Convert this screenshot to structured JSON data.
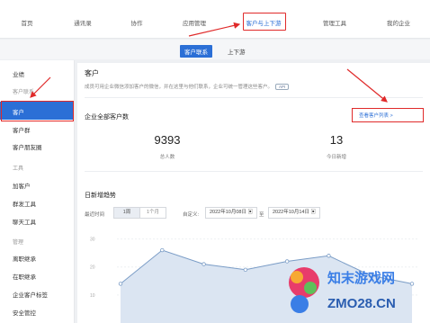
{
  "topnav": {
    "items": [
      "首页",
      "通讯录",
      "协作",
      "应用管理",
      "客户与上下游",
      "管理工具",
      "我的企业"
    ],
    "active_index": 4
  },
  "subtabs": {
    "items": [
      "客户联系",
      "上下游"
    ],
    "active_index": 0
  },
  "sidebar": {
    "items": [
      {
        "label": "业绩",
        "group": false
      },
      {
        "label": "客户联系",
        "group": true
      },
      {
        "label": "客户",
        "group": false,
        "active": true
      },
      {
        "label": "客户群",
        "group": false
      },
      {
        "label": "客户朋友圈",
        "group": false
      },
      {
        "label": "工具",
        "group": true
      },
      {
        "label": "加客户",
        "group": false
      },
      {
        "label": "群发工具",
        "group": false
      },
      {
        "label": "聊天工具",
        "group": false
      },
      {
        "label": "管理",
        "group": true
      },
      {
        "label": "离职继承",
        "group": false
      },
      {
        "label": "在职继承",
        "group": false
      },
      {
        "label": "企业客户标签",
        "group": false
      },
      {
        "label": "安全管控",
        "group": false
      }
    ]
  },
  "main": {
    "title": "客户",
    "description": "成员可用企业微信添加客户的微信，并在这里与他们联系，企业可统一管理这些客户。",
    "badge": "API",
    "section_total": "企业全部客户数",
    "view_list_link": "查看客户列表 >",
    "stats": [
      {
        "value": "9393",
        "label": "总人数"
      },
      {
        "value": "13",
        "label": "今日新增"
      }
    ],
    "trend_title": "日新增趋势",
    "recent_label": "最近时间",
    "period_options": [
      "1周",
      "1个月"
    ],
    "custom_label": "自定义:",
    "date_from": "2022年10月08日",
    "date_sep": "至",
    "date_to": "2022年10月14日"
  },
  "chart_data": {
    "type": "area",
    "y_ticks": [
      "30",
      "20",
      "10"
    ],
    "ylim": [
      0,
      35
    ],
    "values": [
      14,
      26,
      21,
      19,
      22,
      24,
      17,
      14
    ],
    "color": "#7a9cc6",
    "fill": "#dbe5f2"
  },
  "watermark": {
    "cn": "知末游戏网",
    "en": "ZMO28.CN"
  },
  "colors": {
    "accent": "#2b6fd6",
    "highlight": "#e02a2a"
  }
}
